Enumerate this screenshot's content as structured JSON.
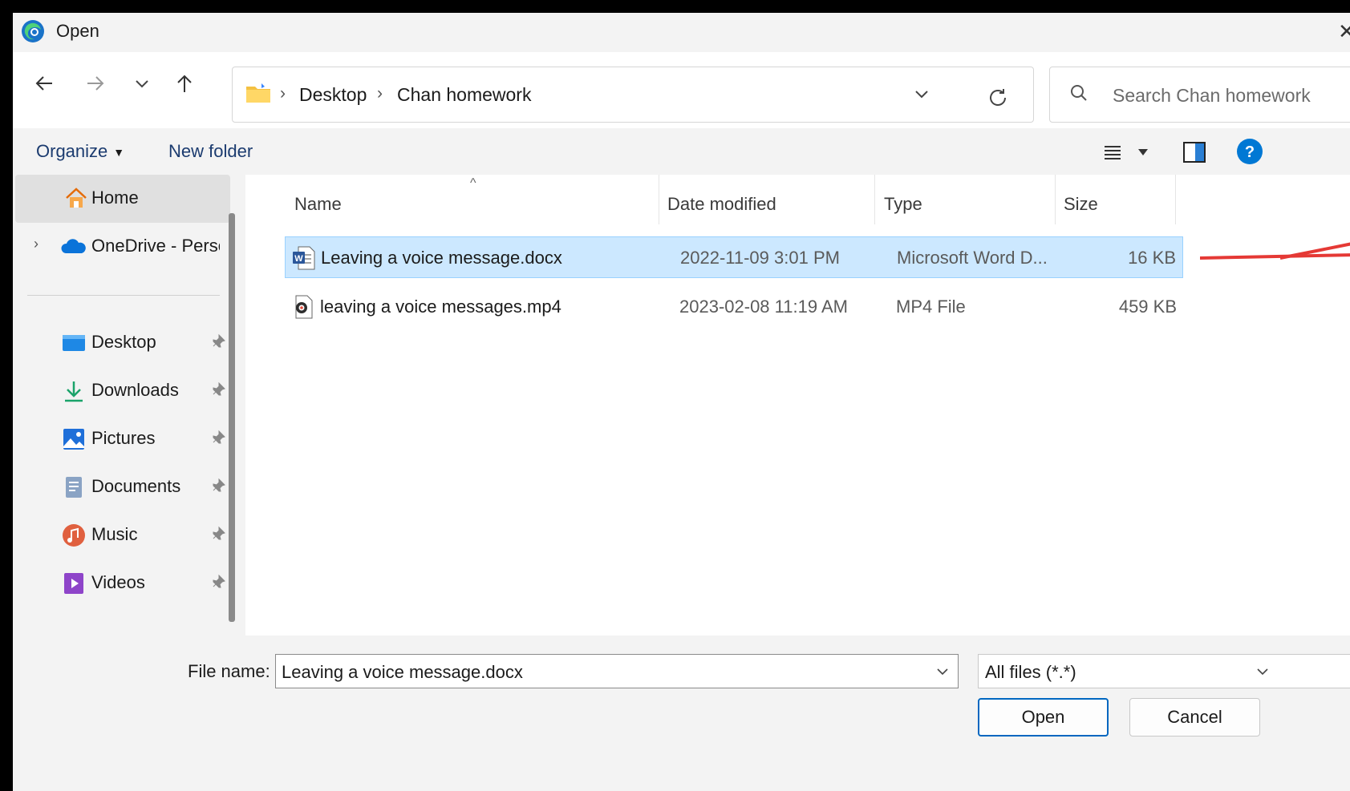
{
  "window": {
    "title": "Open"
  },
  "navigation": {
    "breadcrumb": [
      "Desktop",
      "Chan homework"
    ],
    "search_placeholder": "Search Chan homework"
  },
  "toolbar": {
    "organize_label": "Organize",
    "new_folder_label": "New folder"
  },
  "sidebar": {
    "home": "Home",
    "onedrive": "OneDrive - Personal",
    "quick_access": [
      {
        "label": "Desktop",
        "icon": "desktop-icon"
      },
      {
        "label": "Downloads",
        "icon": "downloads-icon"
      },
      {
        "label": "Pictures",
        "icon": "pictures-icon"
      },
      {
        "label": "Documents",
        "icon": "documents-icon"
      },
      {
        "label": "Music",
        "icon": "music-icon"
      },
      {
        "label": "Videos",
        "icon": "videos-icon"
      }
    ]
  },
  "file_list": {
    "columns": [
      "Name",
      "Date modified",
      "Type",
      "Size"
    ],
    "rows": [
      {
        "name": "Leaving a voice message.docx",
        "date": "2022-11-09 3:01 PM",
        "type": "Microsoft Word D...",
        "size": "16 KB",
        "selected": true,
        "icon": "word-file-icon"
      },
      {
        "name": "leaving a voice messages.mp4",
        "date": "2023-02-08 11:19 AM",
        "type": "MP4 File",
        "size": "459 KB",
        "selected": false,
        "icon": "video-file-icon"
      }
    ]
  },
  "footer": {
    "file_name_label": "File name:",
    "file_name_value": "Leaving a voice message.docx",
    "file_type": "All files (*.*)",
    "open_label": "Open",
    "cancel_label": "Cancel"
  },
  "colors": {
    "accent": "#0067c0",
    "selection": "#cce8ff",
    "annotation_arrow": "#e53935"
  }
}
